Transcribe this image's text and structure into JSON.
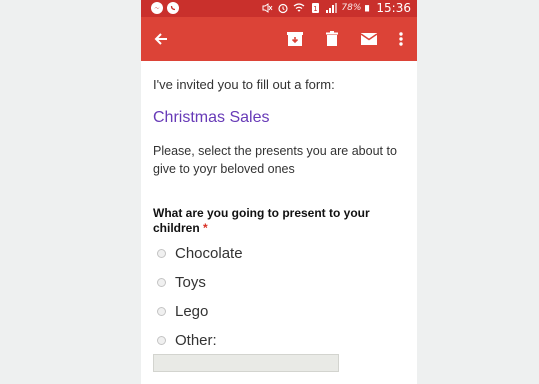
{
  "status_bar": {
    "battery_pct": "78%",
    "time": "15:36"
  },
  "app_bar": {
    "icons": [
      "back-arrow-icon",
      "archive-icon",
      "delete-icon",
      "mail-icon",
      "more-vert-icon"
    ]
  },
  "form": {
    "intro": "I've invited you to fill out a form:",
    "title": "Christmas Sales",
    "description": "Please, select the presents you are about to give to yoyr beloved ones",
    "question": {
      "text": "What are you going to present to your children",
      "required_marker": "*",
      "options": [
        "Chocolate",
        "Toys",
        "Lego",
        "Other:"
      ]
    },
    "other_value": ""
  },
  "colors": {
    "status_bar": "#c9302c",
    "app_bar": "#dc4337",
    "title": "#673ab7",
    "required": "#d93025"
  }
}
